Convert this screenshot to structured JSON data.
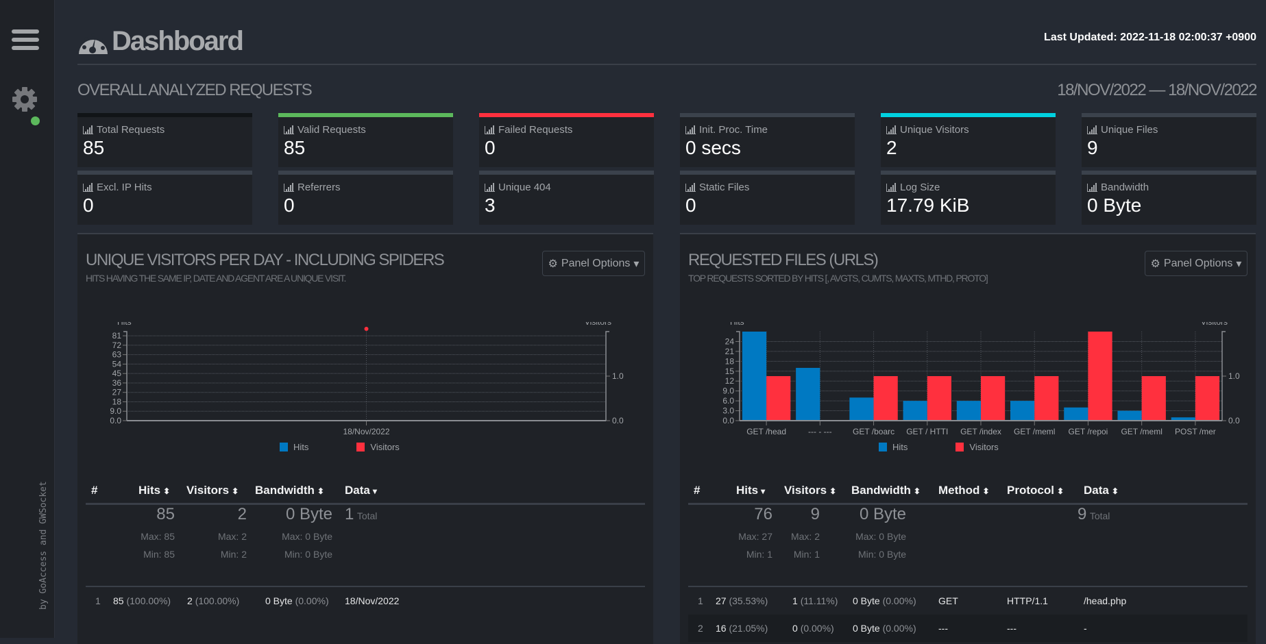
{
  "sidebar": {
    "menu_icon": "hamburger-icon",
    "settings_icon": "gear-icon",
    "status_color": "#5cb85c",
    "byline": "by GoAccess and GWSocket"
  },
  "header": {
    "title": "Dashboard",
    "logo_icon": "dashboard-gauge-icon",
    "last_updated": "Last Updated: 2022-11-18 02:00:37 +0900"
  },
  "overall": {
    "heading": "OVERALL ANALYZED REQUESTS",
    "date_range": "18/NOV/2022 — 18/NOV/2022",
    "cards": [
      {
        "label": "Total Requests",
        "value": "85",
        "accent": "#111417"
      },
      {
        "label": "Valid Requests",
        "value": "85",
        "accent": "#5cb85c"
      },
      {
        "label": "Failed Requests",
        "value": "0",
        "accent": "#ff303e"
      },
      {
        "label": "Init. Proc. Time",
        "value": "0 secs",
        "accent": "#3b424c"
      },
      {
        "label": "Unique Visitors",
        "value": "2",
        "accent": "#00d1e0"
      },
      {
        "label": "Unique Files",
        "value": "9",
        "accent": "#3b424c"
      },
      {
        "label": "Excl. IP Hits",
        "value": "0",
        "accent": "#3b424c"
      },
      {
        "label": "Referrers",
        "value": "0",
        "accent": "#3b424c"
      },
      {
        "label": "Unique 404",
        "value": "3",
        "accent": "#3b424c"
      },
      {
        "label": "Static Files",
        "value": "0",
        "accent": "#3b424c"
      },
      {
        "label": "Log Size",
        "value": "17.79 KiB",
        "accent": "#3b424c"
      },
      {
        "label": "Bandwidth",
        "value": "0 Byte",
        "accent": "#3b424c"
      }
    ]
  },
  "colors": {
    "hits": "#0079c2",
    "visitors": "#ff303e"
  },
  "panels": {
    "visitors": {
      "title": "UNIQUE VISITORS PER DAY - INCLUDING SPIDERS",
      "subtitle": "HITS HAVING THE SAME IP, DATE AND AGENT ARE A UNIQUE VISIT.",
      "options_label": "Panel Options",
      "legend_hits": "Hits",
      "legend_visitors": "Visitors",
      "columns": [
        "#",
        "Hits",
        "Visitors",
        "Bandwidth",
        "Data"
      ],
      "sort_icons": [
        "",
        "sort-both",
        "sort-both",
        "sort-both",
        "sort-down"
      ],
      "summary": {
        "hits": "85",
        "hits_max": "Max: 85",
        "hits_min": "Min: 85",
        "visitors": "2",
        "visitors_max": "Max: 2",
        "visitors_min": "Min: 2",
        "bandwidth": "0 Byte",
        "bandwidth_max": "Max: 0 Byte",
        "bandwidth_min": "Min: 0 Byte",
        "data_total": "1",
        "data_total_label": "Total"
      },
      "rows": [
        {
          "n": "1",
          "hits": "85",
          "hits_pct": "(100.00%)",
          "visitors": "2",
          "visitors_pct": "(100.00%)",
          "bw": "0 Byte",
          "bw_pct": "(0.00%)",
          "data": "18/Nov/2022"
        }
      ]
    },
    "requests": {
      "title": "REQUESTED FILES (URLS)",
      "subtitle": "TOP REQUESTS SORTED BY HITS [, AVGTS, CUMTS, MAXTS, MTHD, PROTO]",
      "options_label": "Panel Options",
      "legend_hits": "Hits",
      "legend_visitors": "Visitors",
      "columns": [
        "#",
        "Hits",
        "Visitors",
        "Bandwidth",
        "Method",
        "Protocol",
        "Data"
      ],
      "sort_icons": [
        "",
        "sort-down",
        "sort-both",
        "sort-both",
        "sort-both",
        "sort-both",
        "sort-both"
      ],
      "summary": {
        "hits": "76",
        "hits_max": "Max: 27",
        "hits_min": "Min: 1",
        "visitors": "9",
        "visitors_max": "Max: 2",
        "visitors_min": "Min: 1",
        "bandwidth": "0 Byte",
        "bandwidth_max": "Max: 0 Byte",
        "bandwidth_min": "Min: 0 Byte",
        "data_total": "9",
        "data_total_label": "Total"
      },
      "rows": [
        {
          "n": "1",
          "hits": "27",
          "hits_pct": "(35.53%)",
          "visitors": "1",
          "visitors_pct": "(11.11%)",
          "bw": "0 Byte",
          "bw_pct": "(0.00%)",
          "method": "GET",
          "protocol": "HTTP/1.1",
          "data": "/head.php"
        },
        {
          "n": "2",
          "hits": "16",
          "hits_pct": "(21.05%)",
          "visitors": "0",
          "visitors_pct": "(0.00%)",
          "bw": "0 Byte",
          "bw_pct": "(0.00%)",
          "method": "---",
          "protocol": "---",
          "data": "-"
        }
      ]
    }
  },
  "chart_data": [
    {
      "type": "line",
      "title": "Unique Visitors Per Day - Including Spiders",
      "categories": [
        "18/Nov/2022"
      ],
      "series": [
        {
          "name": "Hits",
          "axis": "left",
          "values": [
            85
          ]
        },
        {
          "name": "Visitors",
          "axis": "right",
          "values": [
            2
          ]
        }
      ],
      "ylabel": "Hits",
      "y2label": "Visitors",
      "yticks": [
        "0.0",
        "9.0",
        "18",
        "27",
        "36",
        "45",
        "54",
        "63",
        "72",
        "81"
      ],
      "y2ticks": [
        "0.0",
        "1.0"
      ],
      "ylim": [
        0,
        85
      ],
      "y2lim": [
        0,
        2
      ],
      "grid": true,
      "legend": "bottom"
    },
    {
      "type": "bar",
      "title": "Requested Files (URLs)",
      "categories": [
        "GET /head",
        "--- - ---",
        "GET /boarc",
        "GET / HTTI",
        "GET /index",
        "GET /meml",
        "GET /repoi",
        "GET /meml",
        "POST /mer"
      ],
      "series": [
        {
          "name": "Hits",
          "axis": "left",
          "values": [
            27,
            16,
            7,
            6,
            6,
            6,
            4,
            3,
            1
          ]
        },
        {
          "name": "Visitors",
          "axis": "right",
          "values": [
            1,
            0,
            1,
            1,
            1,
            1,
            2,
            1,
            1
          ]
        }
      ],
      "ylabel": "Hits",
      "y2label": "Visitors",
      "yticks": [
        "0.0",
        "3.0",
        "6.0",
        "9.0",
        "12",
        "15",
        "18",
        "21",
        "24"
      ],
      "y2ticks": [
        "0.0",
        "1.0"
      ],
      "ylim": [
        0,
        27
      ],
      "y2lim": [
        0,
        2
      ],
      "grid": true,
      "legend": "bottom"
    }
  ]
}
